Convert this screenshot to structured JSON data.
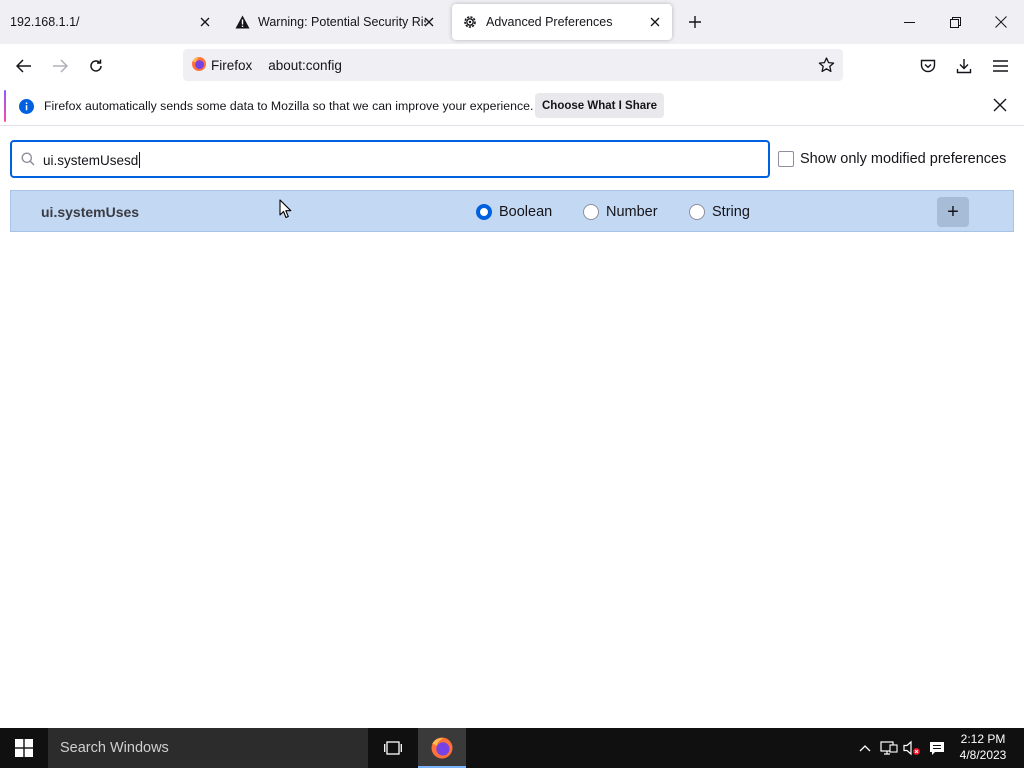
{
  "tabs": [
    {
      "label": "192.168.1.1/"
    },
    {
      "label": "Warning: Potential Security Risk Ahead"
    },
    {
      "label": "Advanced Preferences"
    }
  ],
  "navbar": {
    "identity_label": "Firefox",
    "url": "about:config"
  },
  "notification": {
    "message": "Firefox automatically sends some data to Mozilla so that we can improve your experience.",
    "button_label": "Choose What I Share"
  },
  "search": {
    "value": "ui.systemUsesd",
    "modified_label": "Show only modified preferences"
  },
  "pref_row": {
    "name": "ui.systemUses",
    "types": [
      "Boolean",
      "Number",
      "String"
    ],
    "selected_type": "Boolean",
    "add_label": "+"
  },
  "taskbar": {
    "search_placeholder": "Search Windows",
    "time": "2:12 PM",
    "date": "4/8/2023"
  },
  "colors": {
    "accent": "#0061e0",
    "row_highlight": "#c3d9f3"
  }
}
